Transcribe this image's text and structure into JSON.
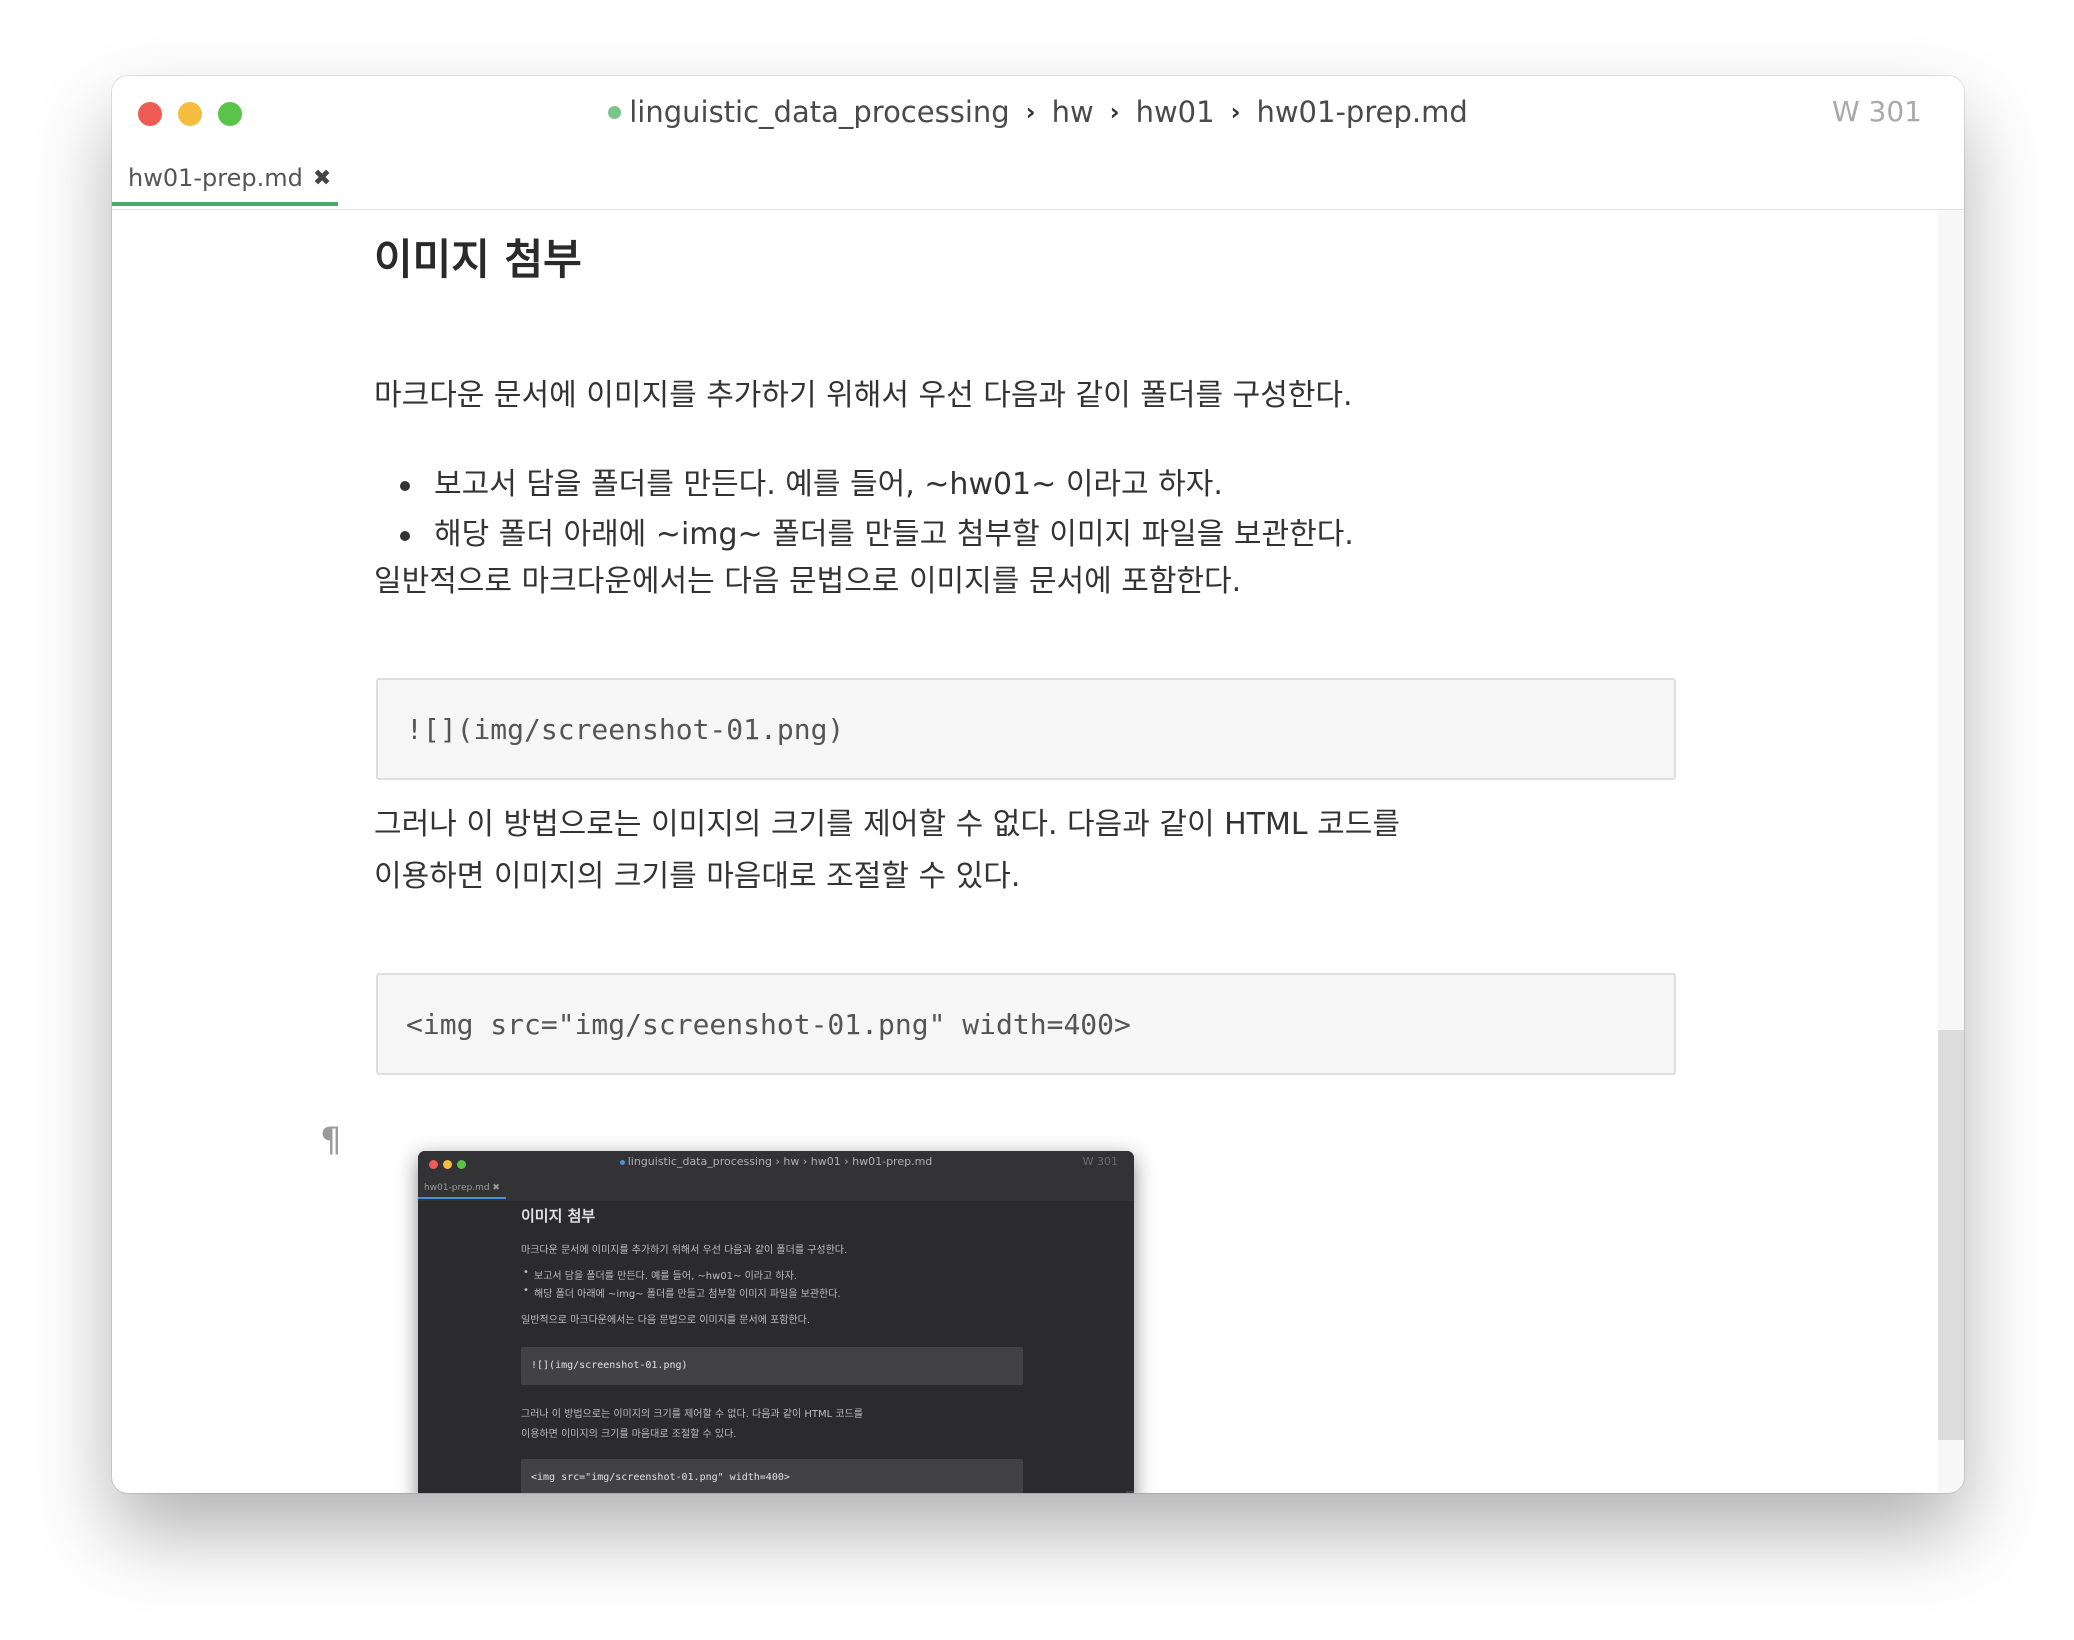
{
  "window": {
    "breadcrumb": [
      "linguistic_data_processing",
      "hw",
      "hw01",
      "hw01-prep.md"
    ],
    "word_count": "W 301",
    "tab": {
      "label": "hw01-prep.md",
      "close": "✖"
    }
  },
  "document": {
    "heading": "이미지 첨부",
    "intro": "마크다운 문서에 이미지를 추가하기 위해서 우선 다음과 같이 폴더를 구성한다.",
    "bullets": [
      "보고서 담을 폴더를 만든다. 예를 들어, ~hw01~ 이라고 하자.",
      "해당 폴더 아래에 ~img~ 폴더를 만들고 첨부할 이미지 파일을 보관한다."
    ],
    "syntax_note": "일반적으로 마크다운에서는 다음 문법으로 이미지를 문서에 포함한다.",
    "code1": "![](img/screenshot-01.png)",
    "html_note_1": "그러나 이 방법으로는 이미지의 크기를 제어할 수 없다. 다음과 같이 HTML 코드를",
    "html_note_2": "이용하면 이미지의 크기를 마음대로 조절할 수 있다.",
    "code2": "<img src=\"img/screenshot-01.png\" width=400>",
    "pilcrow": "¶"
  },
  "embedded_screenshot": {
    "breadcrumb": "linguistic_data_processing  ›  hw  ›  hw01  ›  hw01-prep.md",
    "word_count": "W 301",
    "tab": "hw01-prep.md ✖",
    "heading": "이미지 첨부",
    "intro": "마크다운 문서에 이미지를 추가하기 위해서 우선 다음과 같이 폴더를 구성한다.",
    "bullet_1": "보고서 담을 폴더를 만든다. 예를 들어, ~hw01~ 이라고 하자.",
    "bullet_2": "해당 폴더 아래에 ~img~ 폴더를 만들고 첨부할 이미지 파일을 보관한다.",
    "syntax_note": "일반적으로 마크다운에서는 다음 문법으로 이미지를 문서에 포함한다.",
    "code1": "![](img/screenshot-01.png)",
    "html_note_1": "그러나 이 방법으로는 이미지의 크기를 제어할 수 없다. 다음과 같이 HTML 코드를",
    "html_note_2": "이용하면 이미지의 크기를 마음대로 조절할 수 있다.",
    "code2": "<img src=\"img/screenshot-01.png\" width=400>",
    "pilcrow": "¶"
  },
  "colors": {
    "accent_tab_underline": "#4bab6a",
    "breadcrumb_dot": "#7cc58a",
    "code_background": "#f6f6f6",
    "embedded_background": "#2b2b2d"
  }
}
